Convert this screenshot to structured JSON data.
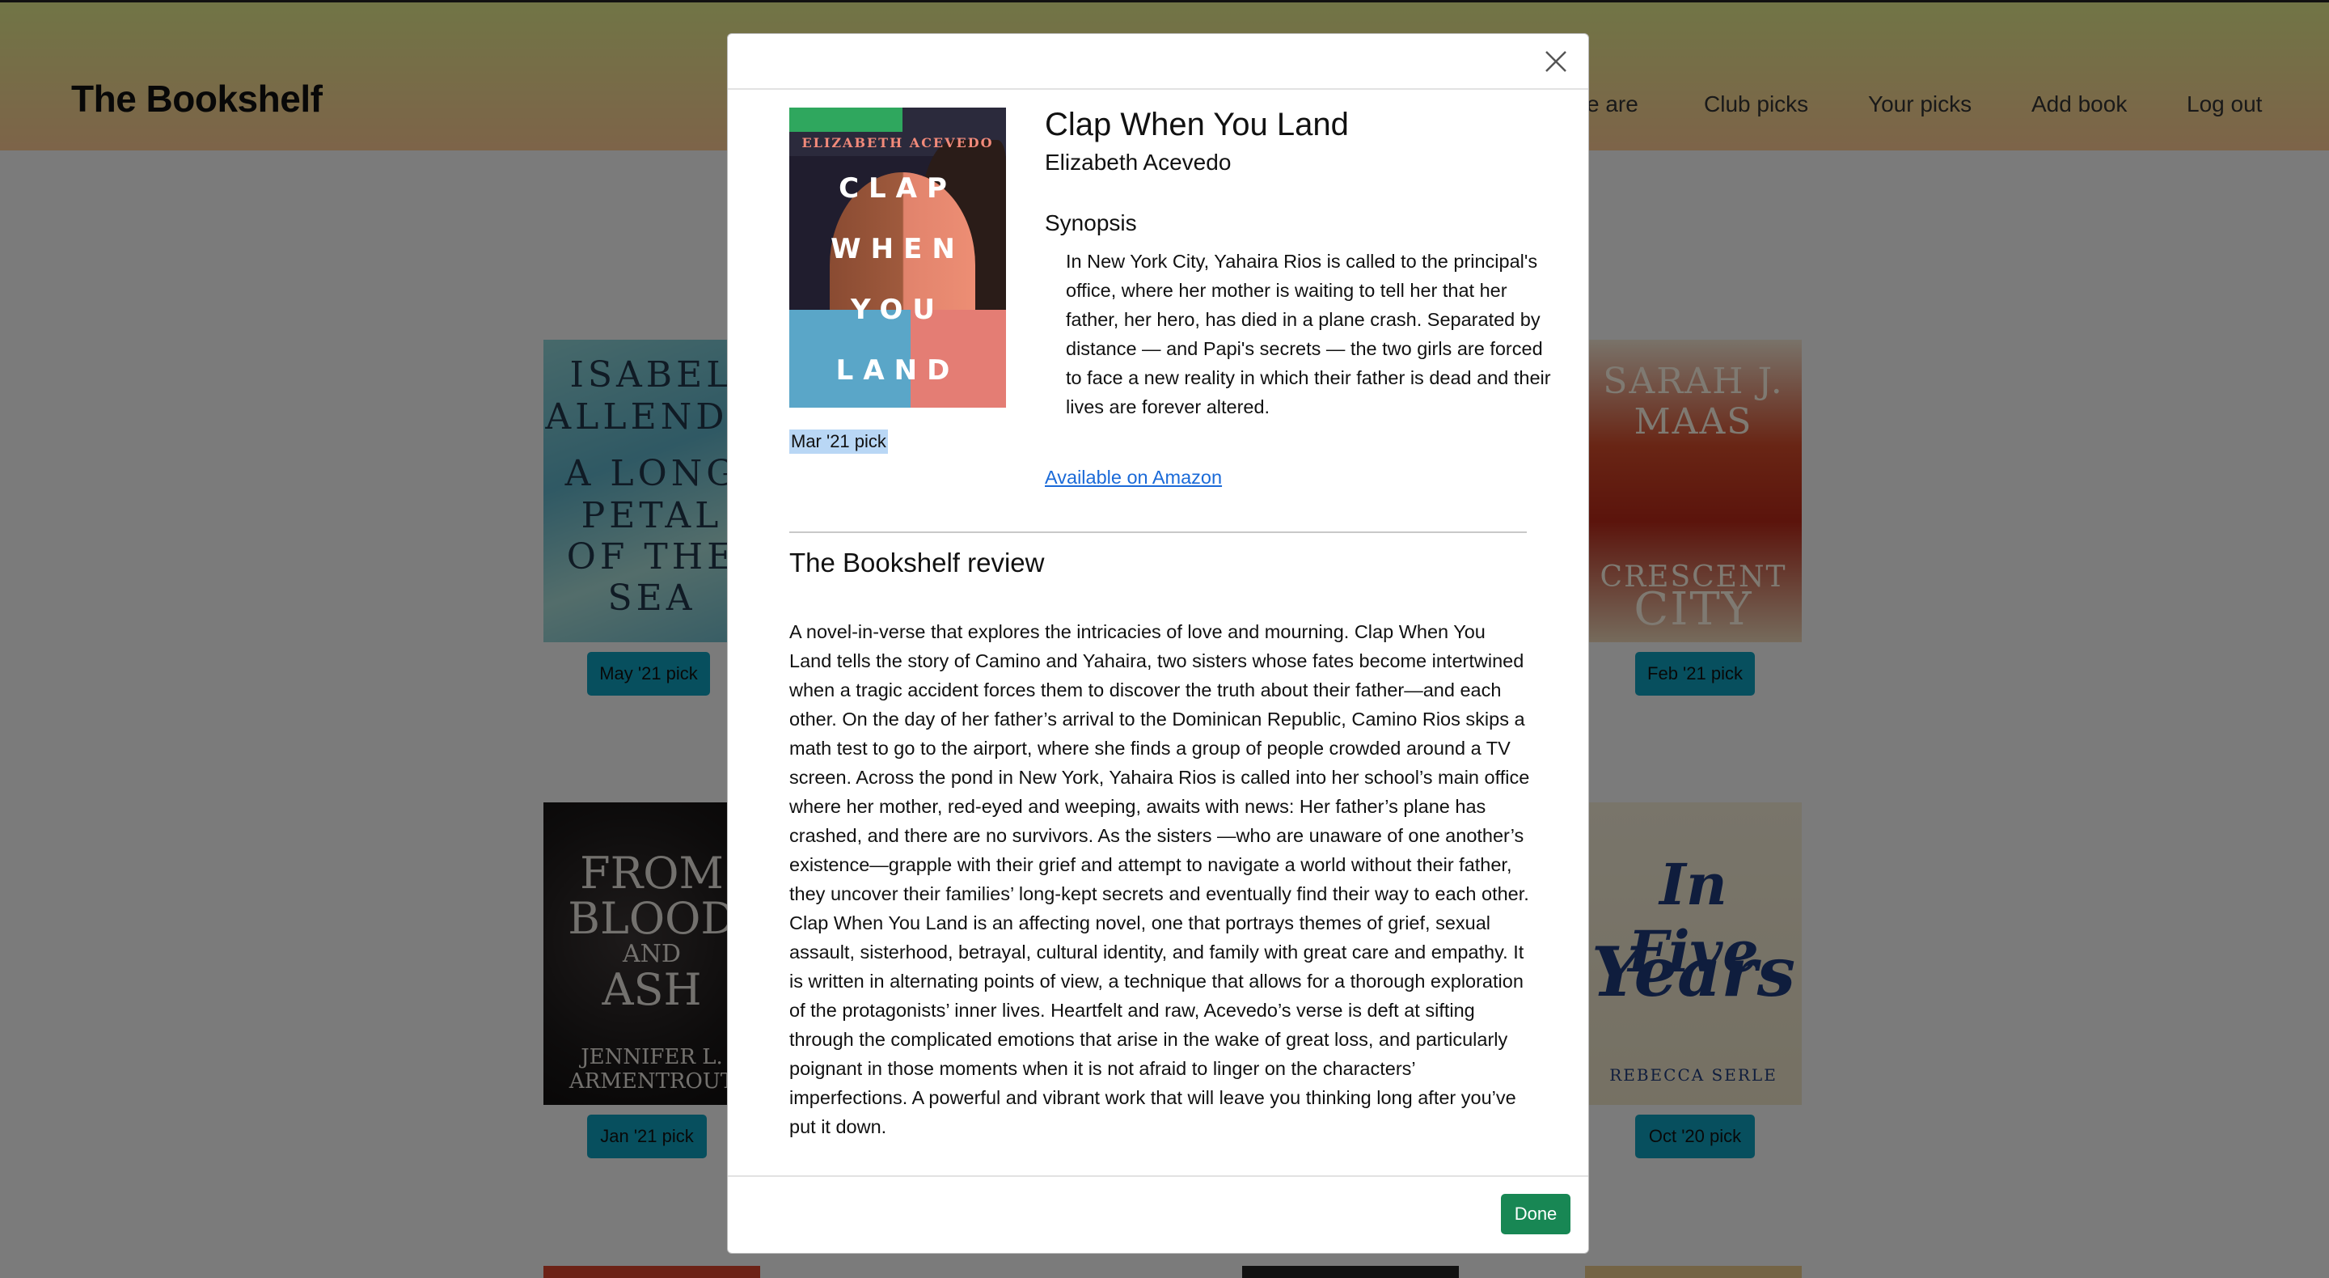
{
  "header": {
    "brand": "The Bookshelf",
    "nav": [
      "ve are",
      "Club picks",
      "Your picks",
      "Add book",
      "Log out"
    ]
  },
  "background_books": [
    {
      "cover_text": [
        "ISABEL",
        "ALLENDE",
        "A LONG",
        "PETAL",
        "OF THE",
        "SEA"
      ],
      "pick": "May '21 pick"
    },
    {
      "cover_text": [
        "SARAH J.",
        "MAAS",
        "CRESCENT",
        "CITY"
      ],
      "pick": "Feb '21 pick"
    },
    {
      "cover_text": [
        "FROM",
        "BLOOD",
        "AND",
        "ASH",
        "JENNIFER L.",
        "ARMENTROUT"
      ],
      "pick": "Jan '21 pick"
    },
    {
      "cover_text": [
        "In Five",
        "Years",
        "REBECCA SERLE"
      ],
      "pick": "Oct '20 pick"
    }
  ],
  "modal": {
    "book": {
      "title": "Clap When You Land",
      "author": "Elizabeth Acevedo",
      "cover_words": [
        "CLAP",
        "WHEN",
        "YOU",
        "LAND"
      ],
      "cover_author": "ELIZABETH ACEVEDO",
      "pick_label": "Mar '21 pick"
    },
    "synopsis_heading": "Synopsis",
    "synopsis": "In New York City, Yahaira Rios is called to the principal's office, where her mother is waiting to tell her that her father, her hero, has died in a plane crash. Separated by distance — and Papi's secrets — the two girls are forced to face a new reality in which their father is dead and their lives are forever altered.",
    "amazon_link": "Available on Amazon",
    "review_heading": "The Bookshelf review",
    "review": "A novel-in-verse that explores the intricacies of love and mourning. Clap When You Land tells the story of Camino and Yahaira, two sisters whose fates become intertwined when a tragic accident forces them to discover the truth about their father—and each other. On the day of her father’s arrival to the Dominican Republic, Camino Rios skips a math test to go to the airport, where she finds a group of people crowded around a TV screen. Across the pond in New York, Yahaira Rios is called into her school’s main office where her mother, red-eyed and weeping, awaits with news: Her father’s plane has crashed, and there are no survivors. As the sisters —who are unaware of one another’s existence—grapple with their grief and attempt to navigate a world without their father, they uncover their families’ long-kept secrets and eventually find their way to each other. Clap When You Land is an affecting novel, one that portrays themes of grief, sexual assault, sisterhood, betrayal, cultural identity, and family with great care and empathy. It is written in alternating points of view, a technique that allows for a thorough exploration of the protagonists’ inner lives. Heartfelt and raw, Acevedo’s verse is deft at sifting through the complicated emotions that arise in the wake of great loss, and particularly poignant in those moments when it is not afraid to linger on the characters’ imperfections. A powerful and vibrant work that will leave you thinking long after you’ve put it down.",
    "done_label": "Done"
  },
  "colors": {
    "pick_badge": "#0f9fbd",
    "done_button": "#188754",
    "link": "#1a6ad8",
    "overlay": "rgba(0,0,0,0.5)"
  }
}
